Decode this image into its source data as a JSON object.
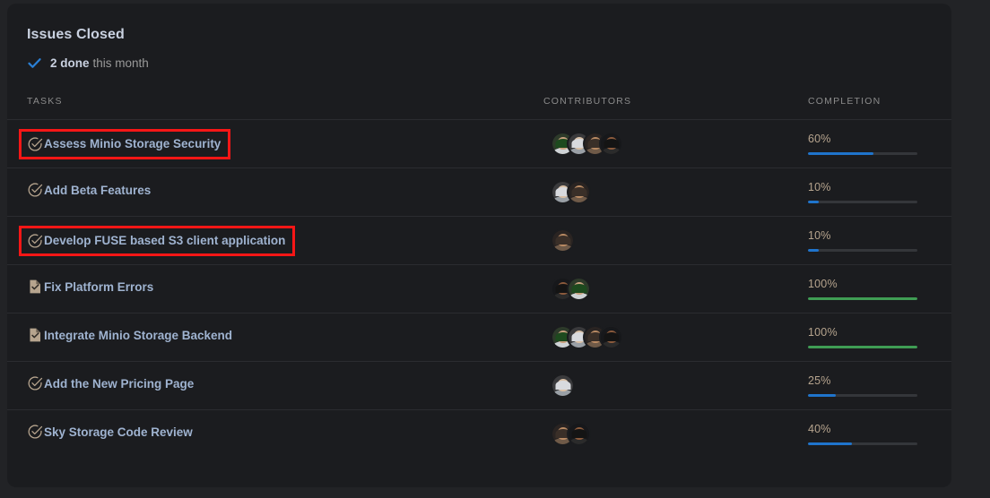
{
  "card": {
    "title": "Issues Closed",
    "subtitle_icon": "check-icon",
    "subtitle_strong": "2 done",
    "subtitle_rest": "this month"
  },
  "table": {
    "headers": {
      "tasks": "TASKS",
      "contributors": "CONTRIBUTORS",
      "completion": "COMPLETION"
    },
    "rows": [
      {
        "task": "Assess Minio Storage Security",
        "icon": "task-check-circle-icon",
        "flagged": true,
        "contributors": 4,
        "completion_label": "60%",
        "completion_value": 60,
        "bar_color": "#1f74cc"
      },
      {
        "task": "Add Beta Features",
        "icon": "task-check-circle-icon",
        "flagged": false,
        "contributors": 2,
        "completion_label": "10%",
        "completion_value": 10,
        "bar_color": "#1f74cc"
      },
      {
        "task": "Develop FUSE based S3 client application",
        "icon": "task-check-circle-icon",
        "flagged": true,
        "contributors": 1,
        "completion_label": "10%",
        "completion_value": 10,
        "bar_color": "#1f74cc"
      },
      {
        "task": "Fix Platform Errors",
        "icon": "document-check-icon",
        "flagged": false,
        "contributors": 2,
        "completion_label": "100%",
        "completion_value": 100,
        "bar_color": "#3f9d54"
      },
      {
        "task": "Integrate Minio Storage Backend",
        "icon": "document-check-icon",
        "flagged": false,
        "contributors": 4,
        "completion_label": "100%",
        "completion_value": 100,
        "bar_color": "#3f9d54"
      },
      {
        "task": "Add the New Pricing Page",
        "icon": "task-check-circle-icon",
        "flagged": false,
        "contributors": 1,
        "completion_label": "25%",
        "completion_value": 25,
        "bar_color": "#1f74cc"
      },
      {
        "task": "Sky Storage Code Review",
        "icon": "task-check-circle-icon",
        "flagged": false,
        "contributors": 2,
        "completion_label": "40%",
        "completion_value": 40,
        "bar_color": "#1f74cc"
      }
    ]
  },
  "colors": {
    "page_bg": "#222326",
    "panel_bg": "#1b1c1f",
    "divider": "#2b2c30",
    "link_text": "#9fb3d0",
    "muted_text": "#8b8b8b",
    "accent_blue": "#2a7fd4",
    "accent_green": "#3f9d54",
    "pct_text": "#b6a48e",
    "annotation_red": "#f61616"
  },
  "avatar_palettes": [
    {
      "bg": "#2d3a2a",
      "hair": "#1d4a1e",
      "face": "#c8a07e",
      "shoulder": "#cfd3d6"
    },
    {
      "bg": "#3a3a3c",
      "hair": "#d8dade",
      "face": "#d9c0a6",
      "shoulder": "#9aa0a6"
    },
    {
      "bg": "#2a2422",
      "hair": "#3a2f28",
      "face": "#b98a63",
      "shoulder": "#6f5a48"
    },
    {
      "bg": "#17181b",
      "hair": "#141414",
      "face": "#8b5a3c",
      "shoulder": "#2b2b2b"
    }
  ]
}
